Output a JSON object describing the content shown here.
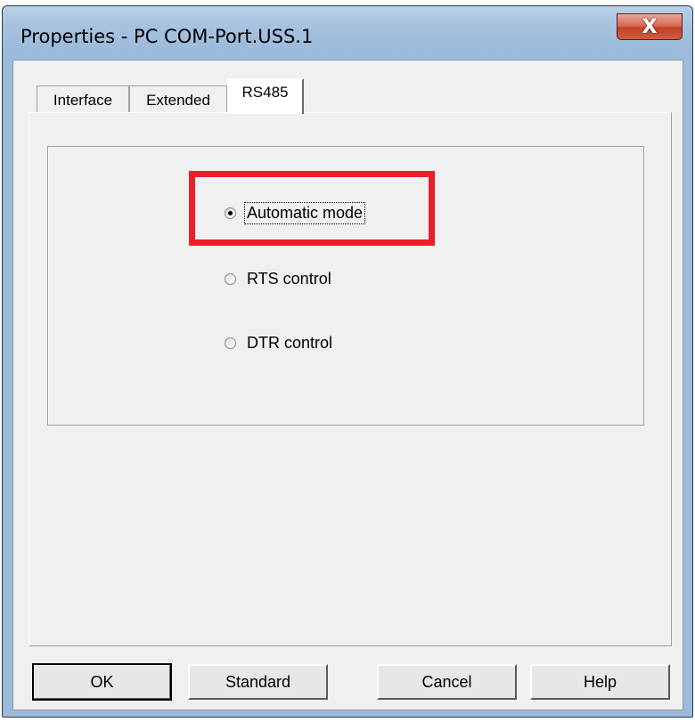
{
  "window": {
    "title": "Properties - PC COM-Port.USS.1",
    "close_label": "X"
  },
  "tabs": [
    {
      "label": "Interface",
      "active": false
    },
    {
      "label": "Extended",
      "active": false
    },
    {
      "label": "RS485",
      "active": true
    }
  ],
  "rs485": {
    "options": [
      {
        "label": "Automatic mode",
        "checked": true
      },
      {
        "label": "RTS control",
        "checked": false
      },
      {
        "label": "DTR control",
        "checked": false
      }
    ]
  },
  "buttons": {
    "ok": "OK",
    "standard": "Standard",
    "cancel": "Cancel",
    "help": "Help"
  },
  "colors": {
    "highlight": "#e8202a",
    "title_bar": "#9cbada",
    "close_button": "#c0402a"
  }
}
